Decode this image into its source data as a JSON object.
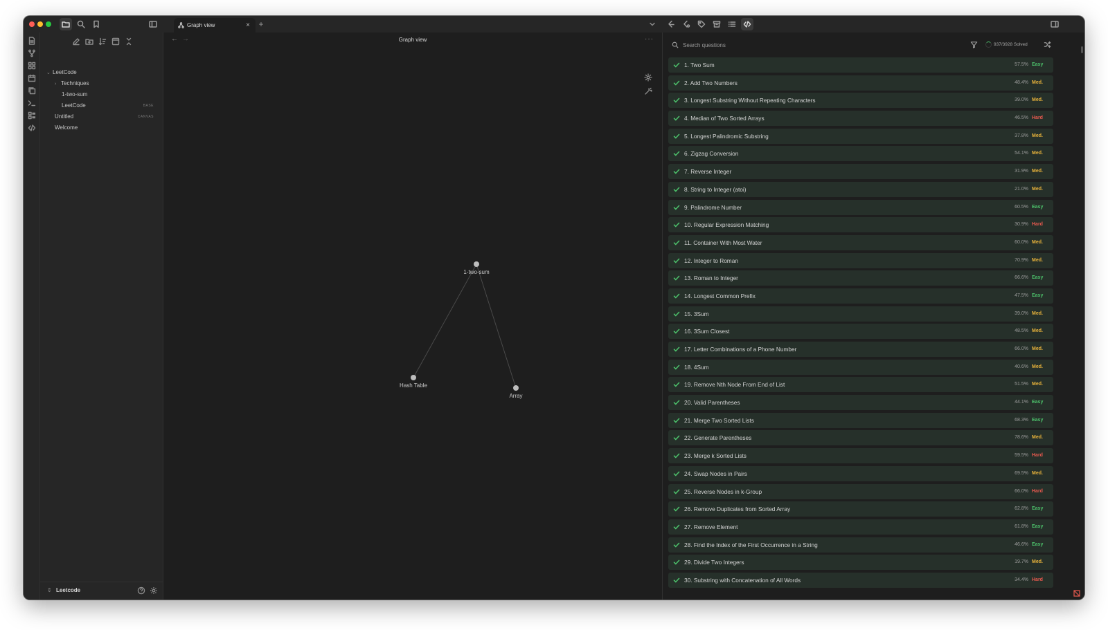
{
  "tabs": [
    {
      "label": "Graph view",
      "icon": "graph-icon"
    }
  ],
  "sidebar": {
    "tree": [
      {
        "label": "LeetCode",
        "type": "folder-open"
      },
      {
        "label": "Techniques",
        "type": "folder-collapsed"
      },
      {
        "label": "1-two-sum",
        "type": "file"
      },
      {
        "label": "LeetCode",
        "type": "file",
        "tag": "BASE"
      },
      {
        "label": "Untitled",
        "type": "file",
        "tag": "CANVAS"
      },
      {
        "label": "Welcome",
        "type": "file"
      }
    ],
    "vault_name": "Leetcode"
  },
  "graph": {
    "title": "Graph view",
    "nodes": [
      {
        "id": "1-two-sum",
        "label": "1-two-sum"
      },
      {
        "id": "hash-table",
        "label": "Hash Table"
      },
      {
        "id": "array",
        "label": "Array"
      }
    ],
    "edges": [
      [
        "1-two-sum",
        "hash-table"
      ],
      [
        "1-two-sum",
        "array"
      ]
    ]
  },
  "questions": {
    "search_placeholder": "Search questions",
    "solved_text": "937/3928 Solved",
    "colors": {
      "easy": "#4cbf6a",
      "medium": "#e8b33b",
      "hard": "#e85a4f"
    },
    "items": [
      {
        "title": "1. Two Sum",
        "rate": "57.5%",
        "difficulty": "Easy"
      },
      {
        "title": "2. Add Two Numbers",
        "rate": "48.4%",
        "difficulty": "Med."
      },
      {
        "title": "3. Longest Substring Without Repeating Characters",
        "rate": "39.0%",
        "difficulty": "Med."
      },
      {
        "title": "4. Median of Two Sorted Arrays",
        "rate": "46.5%",
        "difficulty": "Hard"
      },
      {
        "title": "5. Longest Palindromic Substring",
        "rate": "37.8%",
        "difficulty": "Med."
      },
      {
        "title": "6. Zigzag Conversion",
        "rate": "54.1%",
        "difficulty": "Med."
      },
      {
        "title": "7. Reverse Integer",
        "rate": "31.9%",
        "difficulty": "Med."
      },
      {
        "title": "8. String to Integer (atoi)",
        "rate": "21.0%",
        "difficulty": "Med."
      },
      {
        "title": "9. Palindrome Number",
        "rate": "60.5%",
        "difficulty": "Easy"
      },
      {
        "title": "10. Regular Expression Matching",
        "rate": "30.9%",
        "difficulty": "Hard"
      },
      {
        "title": "11. Container With Most Water",
        "rate": "60.0%",
        "difficulty": "Med."
      },
      {
        "title": "12. Integer to Roman",
        "rate": "70.9%",
        "difficulty": "Med."
      },
      {
        "title": "13. Roman to Integer",
        "rate": "66.6%",
        "difficulty": "Easy"
      },
      {
        "title": "14. Longest Common Prefix",
        "rate": "47.5%",
        "difficulty": "Easy"
      },
      {
        "title": "15. 3Sum",
        "rate": "39.0%",
        "difficulty": "Med."
      },
      {
        "title": "16. 3Sum Closest",
        "rate": "48.5%",
        "difficulty": "Med."
      },
      {
        "title": "17. Letter Combinations of a Phone Number",
        "rate": "66.0%",
        "difficulty": "Med."
      },
      {
        "title": "18. 4Sum",
        "rate": "40.6%",
        "difficulty": "Med."
      },
      {
        "title": "19. Remove Nth Node From End of List",
        "rate": "51.5%",
        "difficulty": "Med."
      },
      {
        "title": "20. Valid Parentheses",
        "rate": "44.1%",
        "difficulty": "Easy"
      },
      {
        "title": "21. Merge Two Sorted Lists",
        "rate": "68.3%",
        "difficulty": "Easy"
      },
      {
        "title": "22. Generate Parentheses",
        "rate": "78.6%",
        "difficulty": "Med."
      },
      {
        "title": "23. Merge k Sorted Lists",
        "rate": "59.5%",
        "difficulty": "Hard"
      },
      {
        "title": "24. Swap Nodes in Pairs",
        "rate": "69.5%",
        "difficulty": "Med."
      },
      {
        "title": "25. Reverse Nodes in k-Group",
        "rate": "66.0%",
        "difficulty": "Hard"
      },
      {
        "title": "26. Remove Duplicates from Sorted Array",
        "rate": "62.8%",
        "difficulty": "Easy"
      },
      {
        "title": "27. Remove Element",
        "rate": "61.8%",
        "difficulty": "Easy"
      },
      {
        "title": "28. Find the Index of the First Occurrence in a String",
        "rate": "46.6%",
        "difficulty": "Easy"
      },
      {
        "title": "29. Divide Two Integers",
        "rate": "19.7%",
        "difficulty": "Med."
      },
      {
        "title": "30. Substring with Concatenation of All Words",
        "rate": "34.4%",
        "difficulty": "Hard"
      }
    ]
  }
}
